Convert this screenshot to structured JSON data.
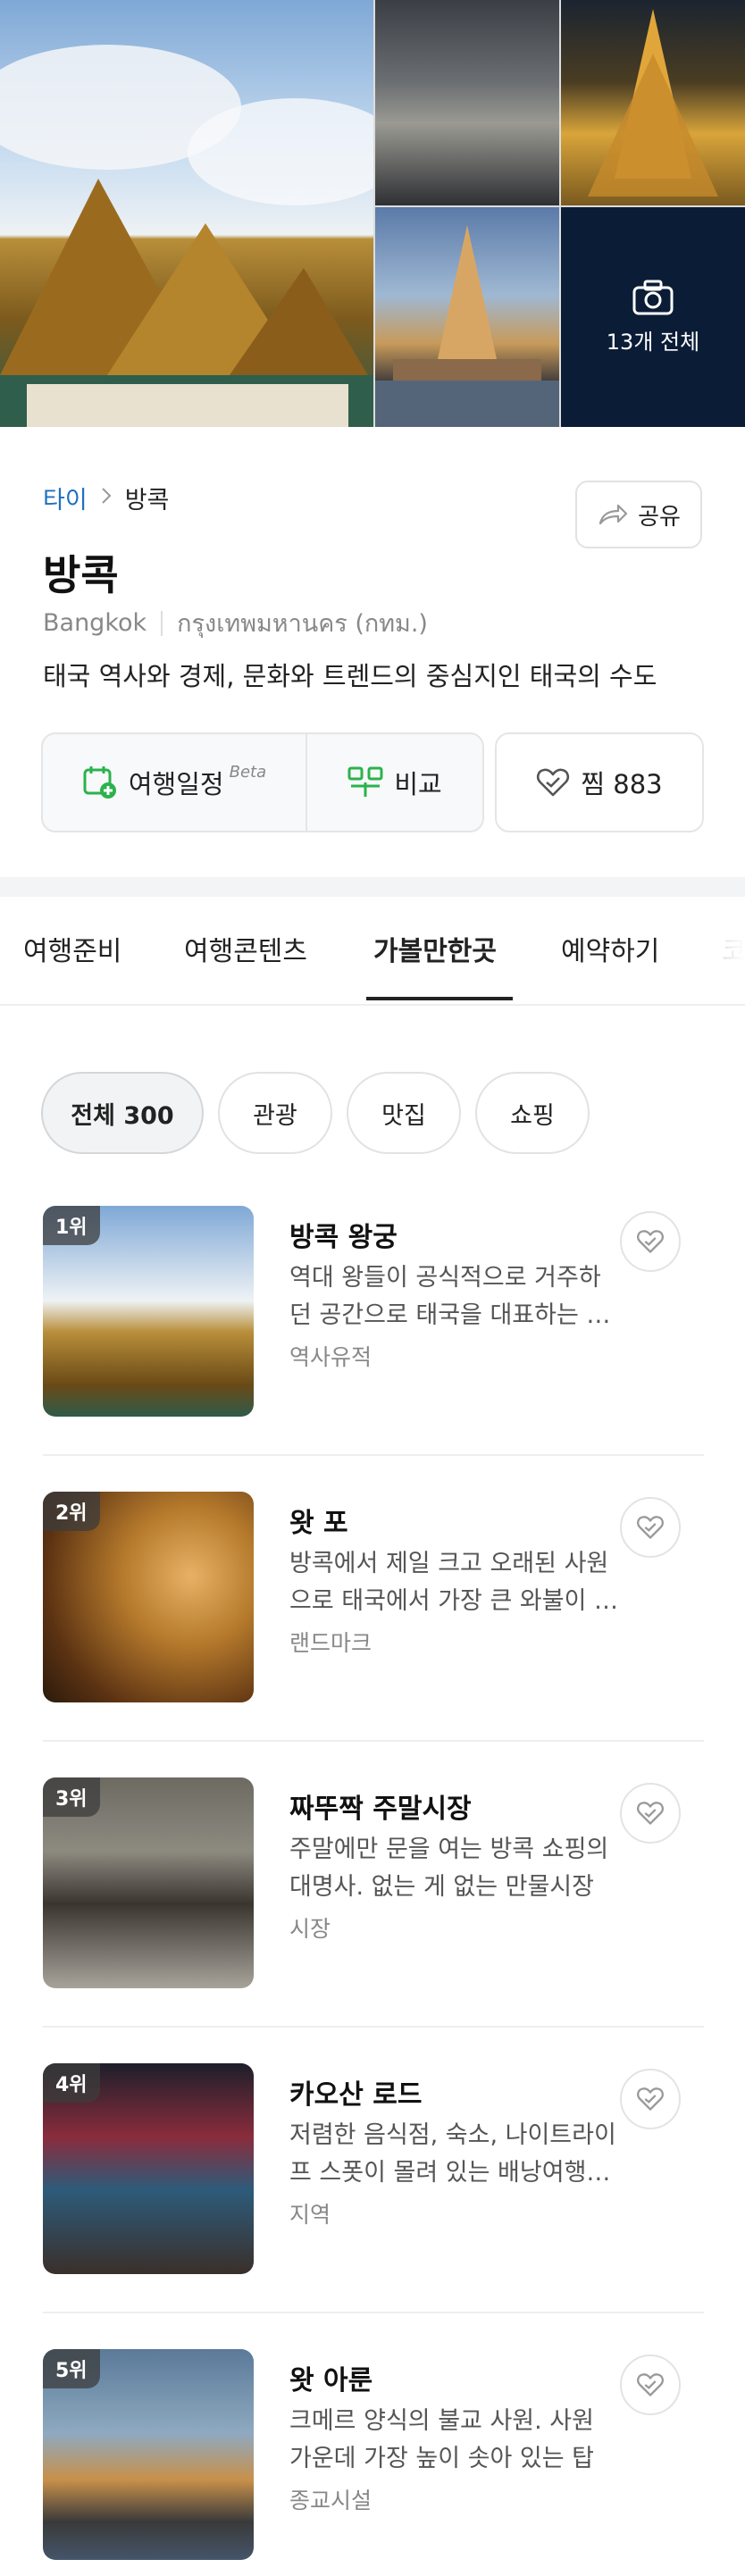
{
  "gallery": {
    "photo_count_label": "13개 전체"
  },
  "breadcrumb": {
    "country": "타이",
    "city": "방콕"
  },
  "share": {
    "label": "공유"
  },
  "city": {
    "name": "방콕",
    "name_en": "Bangkok",
    "name_local": "กรุงเทพมหานคร (กทม.)",
    "description": "태국 역사와 경제, 문화와 트렌드의 중심지인 태국의 수도"
  },
  "actions": {
    "plan_label": "여행일정",
    "plan_badge": "Beta",
    "compare_label": "비교",
    "like_label": "찜 883"
  },
  "tabs": [
    {
      "label": "여행준비"
    },
    {
      "label": "여행콘텐츠"
    },
    {
      "label": "가볼만한곳"
    },
    {
      "label": "예약하기"
    },
    {
      "label": "코"
    }
  ],
  "filters": [
    {
      "label": "전체 300"
    },
    {
      "label": "관광"
    },
    {
      "label": "맛집"
    },
    {
      "label": "쇼핑"
    }
  ],
  "places": [
    {
      "rank": "1위",
      "name": "방콕 왕궁",
      "desc": "역대 왕들이 공식적으로 거주하던 공간으로 태국을 대표하는 명소",
      "category": "역사유적"
    },
    {
      "rank": "2위",
      "name": "왓 포",
      "desc": "방콕에서 제일 크고 오래된 사원으로 태국에서 가장 큰 와불이 있는 곳",
      "category": "랜드마크"
    },
    {
      "rank": "3위",
      "name": "짜뚜짝 주말시장",
      "desc": "주말에만 문을 여는 방콕 쇼핑의 대명사. 없는 게 없는 만물시장",
      "category": "시장"
    },
    {
      "rank": "4위",
      "name": "카오산 로드",
      "desc": "저렴한 음식점, 숙소, 나이트라이프 스폿이 몰려 있는 배낭여행자 거리",
      "category": "지역"
    },
    {
      "rank": "5위",
      "name": "왓 아룬",
      "desc": "크메르 양식의 불교 사원. 사원 가운데 가장 높이 솟아 있는 탑",
      "category": "종교시설"
    }
  ],
  "colors": {
    "link_blue": "#1f6fc1",
    "green_icon": "#2bb24c"
  }
}
